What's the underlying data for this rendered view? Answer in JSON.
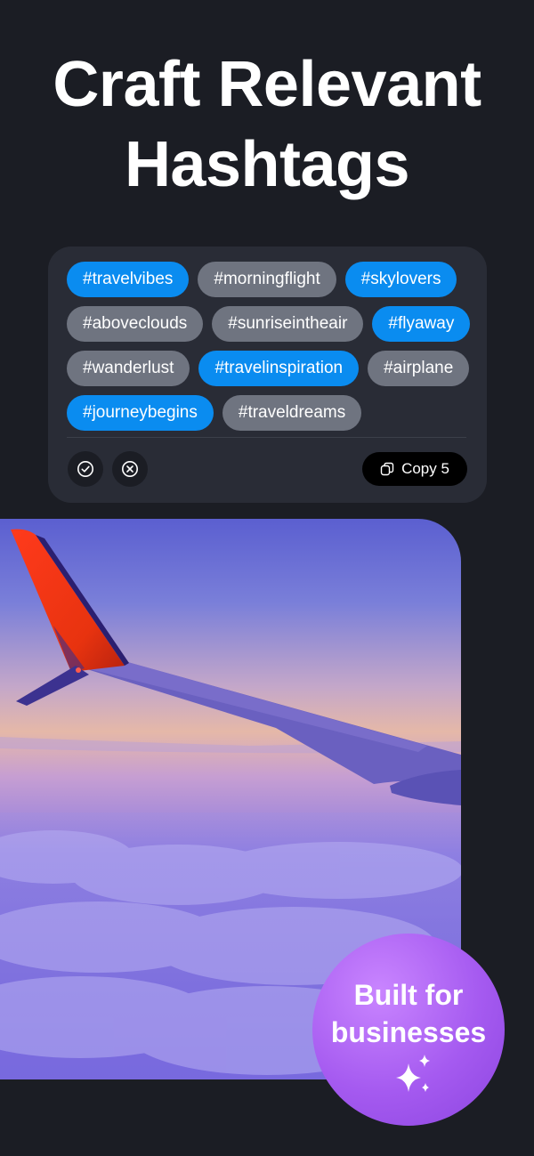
{
  "headline": {
    "line1": "Craft Relevant",
    "line2": "Hashtags"
  },
  "hashtags": {
    "rows": [
      [
        {
          "label": "#travelvibes",
          "selected": true
        },
        {
          "label": "#morningflight",
          "selected": false
        },
        {
          "label": "#skylovers",
          "selected": true
        }
      ],
      [
        {
          "label": "#aboveclouds",
          "selected": false
        },
        {
          "label": "#sunriseintheair",
          "selected": false
        },
        {
          "label": "#flyaway",
          "selected": true
        }
      ],
      [
        {
          "label": "#wanderlust",
          "selected": false
        },
        {
          "label": "#travelinspiration",
          "selected": true
        },
        {
          "label": "#airplane",
          "selected": false
        }
      ],
      [
        {
          "label": "#journeybegins",
          "selected": true
        },
        {
          "label": "#traveldreams",
          "selected": false
        }
      ]
    ],
    "actions": {
      "select_icon": "check-circle-icon",
      "clear_icon": "x-circle-icon"
    },
    "copy_button": {
      "label": "Copy 5",
      "icon": "copy-icon"
    }
  },
  "badge": {
    "line1": "Built for",
    "line2": "businesses",
    "icon": "sparkles-icon"
  },
  "colors": {
    "background": "#1b1d24",
    "card": "#292c36",
    "tag_selected": "#0a8cf0",
    "tag_unselected": "#6f7480",
    "badge": "#a55af0"
  }
}
